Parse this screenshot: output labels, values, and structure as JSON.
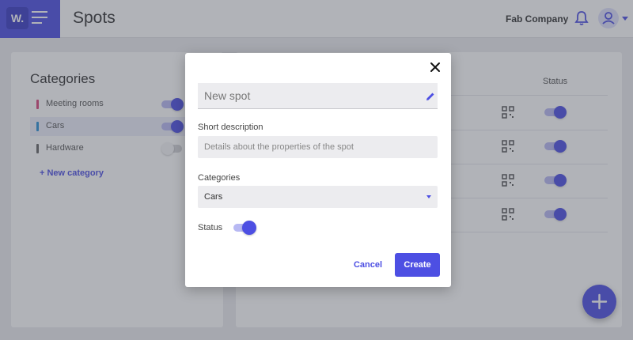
{
  "topbar": {
    "brand": "W.",
    "page_title": "Spots",
    "company": "Fab Company",
    "icons": [
      "menu-icon",
      "bell-icon",
      "user-icon"
    ]
  },
  "categories": {
    "title": "Categories",
    "items": [
      {
        "label": "Meeting rooms",
        "color": "#d9467d",
        "enabled": true,
        "selected": false
      },
      {
        "label": "Cars",
        "color": "#2a8fd6",
        "enabled": true,
        "selected": true
      },
      {
        "label": "Hardware",
        "color": "#666666",
        "enabled": false,
        "selected": false
      }
    ],
    "new_category": "+ New category"
  },
  "spots": {
    "status_header": "Status",
    "rows": [
      {
        "status": true
      },
      {
        "status": true
      },
      {
        "status": true
      },
      {
        "status": true
      }
    ]
  },
  "modal": {
    "name_placeholder": "New spot",
    "description_label": "Short description",
    "description_placeholder": "Details about the properties of the spot",
    "categories_label": "Categories",
    "categories_value": "Cars",
    "status_label": "Status",
    "status_on": true,
    "cancel_label": "Cancel",
    "create_label": "Create"
  },
  "colors": {
    "accent": "#4d4fe3",
    "accent_light": "#b8b9f3"
  }
}
